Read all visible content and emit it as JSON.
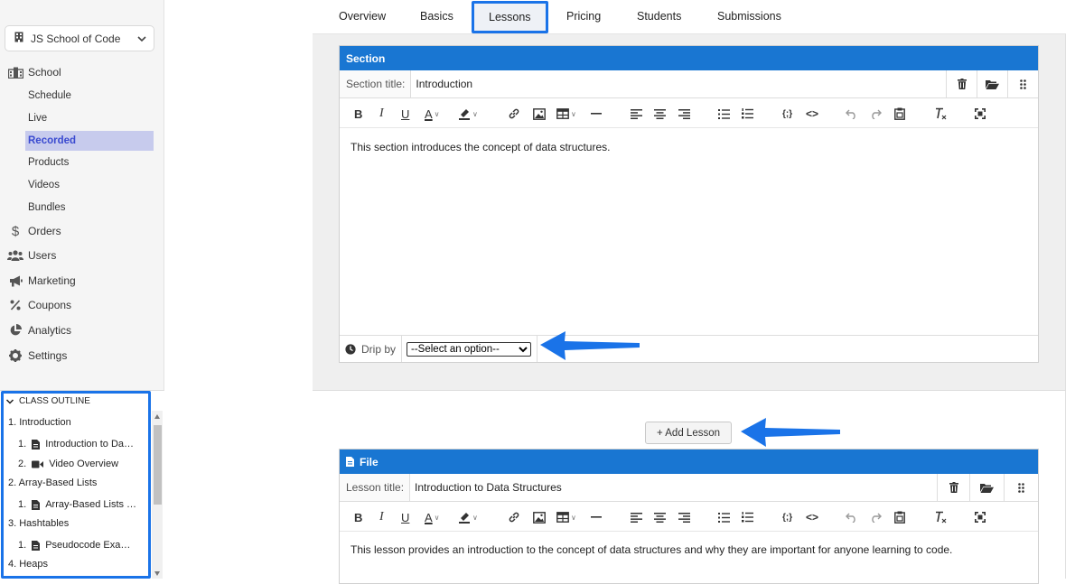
{
  "sidebar": {
    "school_name": "JS School of Code",
    "nav": [
      {
        "label": "School",
        "icon": "school-icon"
      },
      {
        "label": "Schedule"
      },
      {
        "label": "Live"
      },
      {
        "label": "Recorded"
      },
      {
        "label": "Products"
      },
      {
        "label": "Videos"
      },
      {
        "label": "Bundles"
      },
      {
        "label": "Orders",
        "icon": "dollar-icon"
      },
      {
        "label": "Users",
        "icon": "users-icon"
      },
      {
        "label": "Marketing",
        "icon": "megaphone-icon"
      },
      {
        "label": "Coupons",
        "icon": "percent-icon"
      },
      {
        "label": "Analytics",
        "icon": "pie-chart-icon"
      },
      {
        "label": "Settings",
        "icon": "gear-icon"
      }
    ],
    "active_item": "Recorded"
  },
  "outline": {
    "header": "CLASS OUTLINE",
    "rows": [
      {
        "text": "1. Introduction"
      },
      {
        "num": "1.",
        "icon": "file-icon",
        "text": "Introduction to Da…"
      },
      {
        "num": "2.",
        "icon": "video-icon",
        "text": "Video Overview"
      },
      {
        "text": "2. Array-Based Lists"
      },
      {
        "num": "1.",
        "icon": "file-icon",
        "text": "Array-Based Lists …"
      },
      {
        "text": "3. Hashtables"
      },
      {
        "num": "1.",
        "icon": "file-icon",
        "text": "Pseudocode Exa…"
      },
      {
        "text": "4. Heaps"
      }
    ]
  },
  "tabs": [
    {
      "label": "Overview"
    },
    {
      "label": "Basics"
    },
    {
      "label": "Lessons"
    },
    {
      "label": "Pricing"
    },
    {
      "label": "Students"
    },
    {
      "label": "Submissions"
    }
  ],
  "active_tab": "Lessons",
  "section": {
    "header": "Section",
    "title_label": "Section title:",
    "title_value": "Introduction",
    "body": "This section introduces the concept of data structures.",
    "drip_label": "Drip by",
    "drip_selected": "--Select an option--"
  },
  "add_lesson_label": "+ Add Lesson",
  "file_card": {
    "header": "File",
    "title_label": "Lesson title:",
    "title_value": "Introduction to Data Structures",
    "body": "This lesson provides an introduction to the concept of data structures and why they are important for anyone learning to code."
  },
  "colors": {
    "accent": "#1976d2",
    "highlight_border": "#1a73e8",
    "active_nav_bg": "#c7cbed",
    "annotation_arrow": "#1a73e8"
  }
}
